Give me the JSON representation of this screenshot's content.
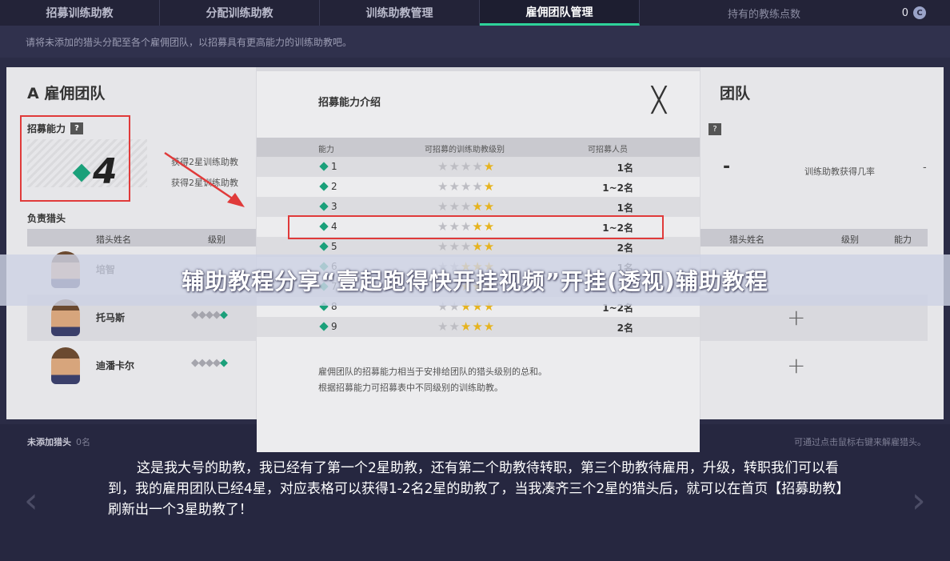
{
  "nav": {
    "tabs": [
      "招募训练助教",
      "分配训练助教",
      "训练助教管理",
      "雇佣团队管理"
    ],
    "active_index": 3,
    "points_label": "持有的教练点数",
    "points_value": "0"
  },
  "subtitle": "请将未添加的猎头分配至各个雇佣团队，以招募具有更高能力的训练助教吧。",
  "team_a": {
    "title": "A 雇佣团队",
    "ability_label": "招募能力",
    "help": "?",
    "ability_value": "4",
    "gains": [
      "获得2星训练助教",
      "获得2星训练助教"
    ],
    "section": "负责猎头",
    "columns": [
      "猎头姓名",
      "级别"
    ],
    "rows": [
      {
        "name": "培智",
        "level_off": "",
        "level_on": ""
      },
      {
        "name": "托马斯",
        "level_off": "◆◆◆◆",
        "level_on": "◆"
      },
      {
        "name": "迪潘卡尔",
        "level_off": "◆◆◆◆",
        "level_on": "◆"
      }
    ]
  },
  "team_c": {
    "title": "团队",
    "help": "?",
    "ability_value": "-",
    "rate_label": "训练助教获得几率",
    "rate_value": "-",
    "columns": [
      "猎头姓名",
      "级别",
      "能力"
    ],
    "plus": "+"
  },
  "bottom": {
    "unadded_label": "未添加猎头",
    "unadded_count": "0名",
    "hint": "可通过点击鼠标右键来解雇猎头。",
    "prev": "‹",
    "next": "›",
    "caption": "这是我大号的助教，我已经有了第一个2星助教，还有第二个助教待转职，第三个助教待雇用，升级，转职我们可以看到，我的雇用团队已经4星，对应表格可以获得1-2名2星的助教了，当我凑齐三个2星的猎头后，就可以在首页【招募助教】刷新出一个3星助教了！"
  },
  "modal": {
    "title": "招募能力介绍",
    "close": "╳",
    "columns": [
      "能力",
      "可招募的训练助教级别",
      "可招募人员"
    ],
    "rows": [
      {
        "level": "1",
        "off": "★★★★",
        "on": "★",
        "count": "1名"
      },
      {
        "level": "2",
        "off": "★★★★",
        "on": "★",
        "count": "1~2名"
      },
      {
        "level": "3",
        "off": "★★★",
        "on": "★★",
        "count": "1名"
      },
      {
        "level": "4",
        "off": "★★★",
        "on": "★★",
        "count": "1~2名"
      },
      {
        "level": "5",
        "off": "★★★",
        "on": "★★",
        "count": "2名"
      },
      {
        "level": "6",
        "off": "★★",
        "on": "★★★",
        "count": "1名"
      },
      {
        "level": "7",
        "off": "★★",
        "on": "★★★",
        "count": "2名"
      },
      {
        "level": "8",
        "off": "★★",
        "on": "★★★",
        "count": "1~2名"
      },
      {
        "level": "9",
        "off": "★★",
        "on": "★★★",
        "count": "2名"
      }
    ],
    "notes": [
      "雇佣团队的招募能力相当于安排给团队的猎头级别的总和。",
      "根据招募能力可招募表中不同级别的训练助教。"
    ]
  },
  "banner": "辅助教程分享“壹起跑得快开挂视频”开挂(透视)辅助教程",
  "colors": {
    "accent": "#2ed39a",
    "diamond": "#1aa07a",
    "star": "#e6b31e",
    "highlight": "#e03a3a"
  }
}
